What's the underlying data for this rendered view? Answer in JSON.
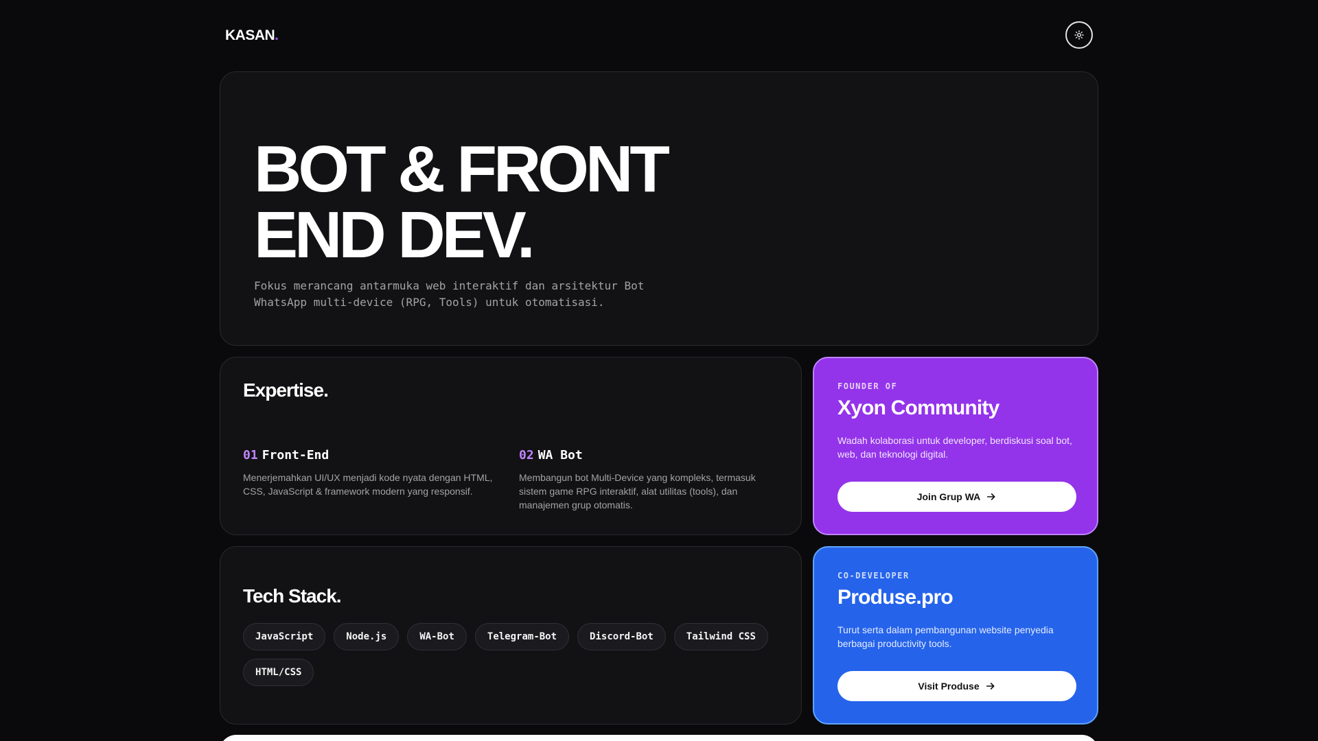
{
  "header": {
    "logo_text": "KASAN",
    "logo_dot": ".",
    "theme_icon": "sun-icon"
  },
  "hero": {
    "title_line1": "BOT & FRONT",
    "title_line2": "END DEV.",
    "description": "Fokus merancang antarmuka web interaktif dan arsitektur Bot WhatsApp multi-device (RPG, Tools) untuk otomatisasi."
  },
  "expertise": {
    "title": "Expertise.",
    "items": [
      {
        "num": "01",
        "name": "Front-End",
        "text": "Menerjemahkan UI/UX menjadi kode nyata dengan HTML, CSS, JavaScript & framework modern yang responsif."
      },
      {
        "num": "02",
        "name": "WA Bot",
        "text": "Membangun bot Multi-Device yang kompleks, termasuk sistem game RPG interaktif, alat utilitas (tools), dan manajemen grup otomatis."
      }
    ]
  },
  "founder_card": {
    "kicker": "FOUNDER OF",
    "title": "Xyon Community",
    "description": "Wadah kolaborasi untuk developer, berdiskusi soal bot, web, dan teknologi digital.",
    "button_label": "Join Grup WA",
    "color": "#9333ea"
  },
  "codev_card": {
    "kicker": "CO-DEVELOPER",
    "title": "Produse.pro",
    "description": "Turut serta dalam pembangunan website penyedia berbagai productivity tools.",
    "button_label": "Visit Produse",
    "color": "#2563eb"
  },
  "tech_stack": {
    "title": "Tech Stack.",
    "chips": [
      "JavaScript",
      "Node.js",
      "WA-Bot",
      "Telegram-Bot",
      "Discord-Bot",
      "Tailwind CSS",
      "HTML/CSS"
    ]
  },
  "colors": {
    "background": "#0a0a0c",
    "card": "#121215",
    "accent_purple": "#c084fc"
  }
}
